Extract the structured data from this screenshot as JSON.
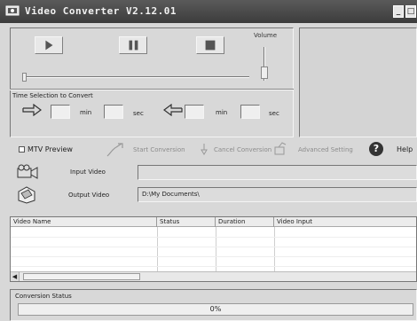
{
  "window": {
    "title": "Video Converter V2.12.01",
    "minimize": "_",
    "restore": "□"
  },
  "player": {
    "play_icon": "play-icon",
    "pause_icon": "pause-icon",
    "stop_icon": "stop-icon",
    "volume_label": "Volume",
    "seek_position": 0.0
  },
  "time_selection": {
    "label": "Time Selection to Convert",
    "start_min": "",
    "start_sec": "",
    "end_min": "",
    "end_sec": "",
    "min_unit": "min",
    "sec_unit": "sec"
  },
  "options": {
    "mtv_preview": "MTV Preview",
    "mtv_checked": false,
    "start_conversion": "Start Conversion",
    "cancel_conversion": "Cancel Conversion",
    "advanced_setting": "Advanced Setting",
    "help": "Help",
    "help_glyph": "?"
  },
  "files": {
    "input_label": "Input Video",
    "input_value": "",
    "output_label": "Output Video",
    "output_value": "D:\\My Documents\\"
  },
  "table": {
    "columns": [
      "Video Name",
      "Status",
      "Duration",
      "Video Input"
    ],
    "rows": []
  },
  "status": {
    "label": "Conversion Status",
    "progress_text": "0%",
    "progress": 0
  }
}
